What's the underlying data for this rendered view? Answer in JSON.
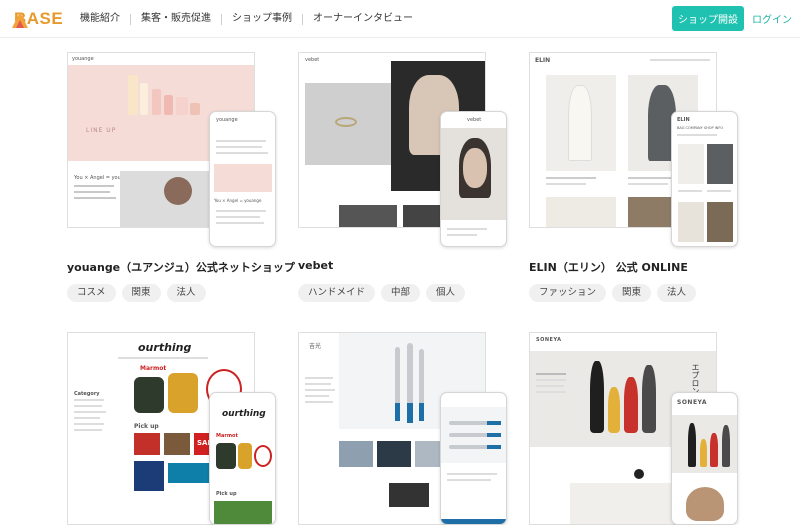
{
  "header": {
    "logo_text": "BASE",
    "nav": [
      "機能紹介",
      "集客・販売促進",
      "ショップ事例",
      "オーナーインタビュー"
    ],
    "open_shop_label": "ショップ開設",
    "login_label": "ログイン"
  },
  "shops": [
    {
      "title": "youange（ユアンジュ）公式ネットショップ",
      "tags": [
        "コスメ",
        "関東",
        "法人"
      ],
      "screenshot_text": {
        "site_name": "youange",
        "hero": "LINE UP",
        "tagline": "You × Angel = youange"
      }
    },
    {
      "title": "vebet",
      "tags": [
        "ハンドメイド",
        "中部",
        "個人"
      ],
      "screenshot_text": {
        "site_name": "vebet"
      }
    },
    {
      "title": "ELIN（エリン） 公式 ONLINE",
      "tags": [
        "ファッション",
        "関東",
        "法人"
      ],
      "screenshot_text": {
        "site_name": "ELIN",
        "menu": "BAG  COMPANY  SHOP INFO"
      }
    },
    {
      "title": "",
      "tags": [],
      "screenshot_text": {
        "site_name": "ourthing",
        "brand": "Marmot",
        "sale": "SALE",
        "section": "Pick up",
        "category": "Category"
      }
    },
    {
      "title": "",
      "tags": [],
      "screenshot_text": {
        "site_name": "吉光"
      }
    },
    {
      "title": "",
      "tags": [],
      "screenshot_text": {
        "site_name": "SONEYA",
        "vertical": "エプロン"
      }
    }
  ]
}
